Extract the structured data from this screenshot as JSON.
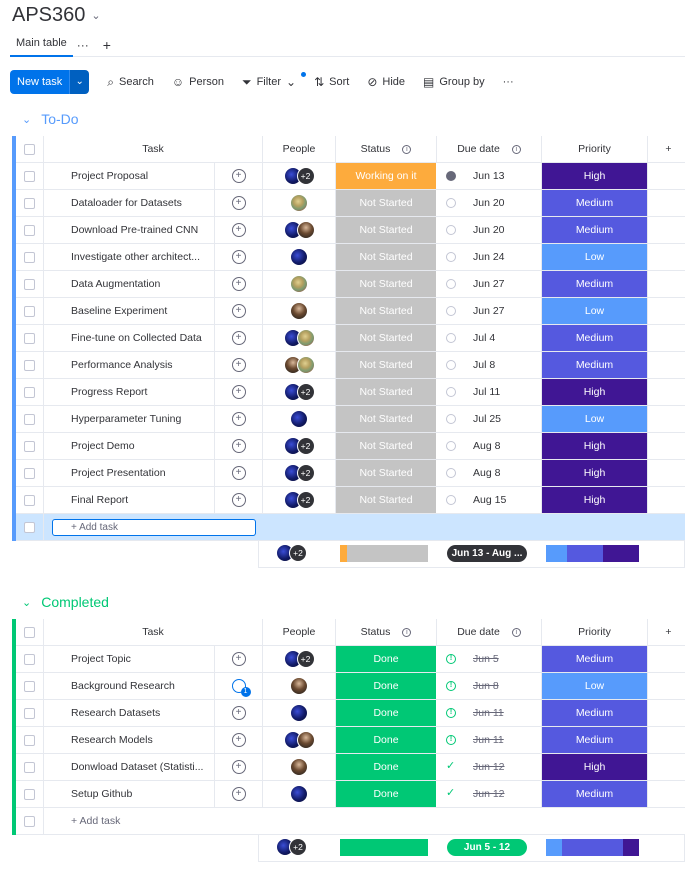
{
  "board": {
    "title": "APS360"
  },
  "view": {
    "tab_label": "Main table",
    "more": "···",
    "add": "+"
  },
  "toolbar": {
    "new_task": "New task",
    "search": "Search",
    "person": "Person",
    "filter": "Filter",
    "sort": "Sort",
    "hide": "Hide",
    "group_by": "Group by",
    "more": "···"
  },
  "columns": {
    "task": "Task",
    "people": "People",
    "status": "Status",
    "due": "Due date",
    "priority": "Priority"
  },
  "colors": {
    "working": "#fdab3d",
    "not_started": "#c4c4c4",
    "done": "#00c875",
    "high": "#401694",
    "medium": "#5559df",
    "low": "#579bfc",
    "todo_group": "#579bfc",
    "completed_group": "#00c875"
  },
  "todo": {
    "title": "To-Do",
    "add_label": "+ Add task",
    "rows": [
      {
        "task": "Project Proposal",
        "people": [
          "a",
          "+2"
        ],
        "status": "Working on it",
        "skey": "working",
        "due_icon": "fill",
        "due": "Jun 13",
        "priority": "High",
        "pkey": "high"
      },
      {
        "task": "Dataloader for Datasets",
        "people": [
          "b"
        ],
        "status": "Not Started",
        "skey": "not_started",
        "due_icon": "circ",
        "due": "Jun 20",
        "priority": "Medium",
        "pkey": "medium"
      },
      {
        "task": "Download Pre-trained CNN",
        "people": [
          "a",
          "c"
        ],
        "status": "Not Started",
        "skey": "not_started",
        "due_icon": "circ",
        "due": "Jun 20",
        "priority": "Medium",
        "pkey": "medium"
      },
      {
        "task": "Investigate other architect...",
        "people": [
          "a"
        ],
        "status": "Not Started",
        "skey": "not_started",
        "due_icon": "circ",
        "due": "Jun 24",
        "priority": "Low",
        "pkey": "low"
      },
      {
        "task": "Data Augmentation",
        "people": [
          "b"
        ],
        "status": "Not Started",
        "skey": "not_started",
        "due_icon": "circ",
        "due": "Jun 27",
        "priority": "Medium",
        "pkey": "medium"
      },
      {
        "task": "Baseline Experiment",
        "people": [
          "c"
        ],
        "status": "Not Started",
        "skey": "not_started",
        "due_icon": "circ",
        "due": "Jun 27",
        "priority": "Low",
        "pkey": "low"
      },
      {
        "task": "Fine-tune on Collected Data",
        "people": [
          "a",
          "b"
        ],
        "status": "Not Started",
        "skey": "not_started",
        "due_icon": "circ",
        "due": "Jul 4",
        "priority": "Medium",
        "pkey": "medium"
      },
      {
        "task": "Performance Analysis",
        "people": [
          "c",
          "b"
        ],
        "status": "Not Started",
        "skey": "not_started",
        "due_icon": "circ",
        "due": "Jul 8",
        "priority": "Medium",
        "pkey": "medium"
      },
      {
        "task": "Progress Report",
        "people": [
          "a",
          "+2"
        ],
        "status": "Not Started",
        "skey": "not_started",
        "due_icon": "circ",
        "due": "Jul 11",
        "priority": "High",
        "pkey": "high"
      },
      {
        "task": "Hyperparameter Tuning",
        "people": [
          "a"
        ],
        "status": "Not Started",
        "skey": "not_started",
        "due_icon": "circ",
        "due": "Jul 25",
        "priority": "Low",
        "pkey": "low"
      },
      {
        "task": "Project Demo",
        "people": [
          "a",
          "+2"
        ],
        "status": "Not Started",
        "skey": "not_started",
        "due_icon": "circ",
        "due": "Aug 8",
        "priority": "High",
        "pkey": "high"
      },
      {
        "task": "Project Presentation",
        "people": [
          "a",
          "+2"
        ],
        "status": "Not Started",
        "skey": "not_started",
        "due_icon": "circ",
        "due": "Aug 8",
        "priority": "High",
        "pkey": "high"
      },
      {
        "task": "Final Report",
        "people": [
          "a",
          "+2"
        ],
        "status": "Not Started",
        "skey": "not_started",
        "due_icon": "circ",
        "due": "Aug 15",
        "priority": "High",
        "pkey": "high"
      }
    ],
    "summary": {
      "people": [
        "a",
        "+2"
      ],
      "status_split": [
        {
          "key": "working",
          "frac": 0.08
        },
        {
          "key": "not_started",
          "frac": 0.92
        }
      ],
      "due_range": "Jun 13 - Aug ...",
      "due_color": "#323338",
      "priority_split": [
        {
          "key": "low",
          "frac": 0.23
        },
        {
          "key": "medium",
          "frac": 0.38
        },
        {
          "key": "high",
          "frac": 0.39
        }
      ]
    }
  },
  "completed": {
    "title": "Completed",
    "add_label": "+ Add task",
    "rows": [
      {
        "task": "Project Topic",
        "people": [
          "a",
          "+2"
        ],
        "update_badge": "",
        "status": "Done",
        "skey": "done",
        "due_icon": "warn",
        "due": "Jun 5",
        "priority": "Medium",
        "pkey": "medium"
      },
      {
        "task": "Background Research",
        "people": [
          "c"
        ],
        "update_badge": "1",
        "status": "Done",
        "skey": "done",
        "due_icon": "warn",
        "due": "Jun 8",
        "priority": "Low",
        "pkey": "low"
      },
      {
        "task": "Research Datasets",
        "people": [
          "a"
        ],
        "update_badge": "",
        "status": "Done",
        "skey": "done",
        "due_icon": "warn",
        "due": "Jun 11",
        "priority": "Medium",
        "pkey": "medium"
      },
      {
        "task": "Research Models",
        "people": [
          "a",
          "c"
        ],
        "update_badge": "",
        "status": "Done",
        "skey": "done",
        "due_icon": "warn",
        "due": "Jun 11",
        "priority": "Medium",
        "pkey": "medium"
      },
      {
        "task": "Donwload Dataset (Statisti...",
        "people": [
          "c"
        ],
        "update_badge": "",
        "status": "Done",
        "skey": "done",
        "due_icon": "check",
        "due": "Jun 12",
        "priority": "High",
        "pkey": "high"
      },
      {
        "task": "Setup Github",
        "people": [
          "a"
        ],
        "update_badge": "",
        "status": "Done",
        "skey": "done",
        "due_icon": "check",
        "due": "Jun 12",
        "priority": "Medium",
        "pkey": "medium"
      }
    ],
    "summary": {
      "people": [
        "a",
        "+2"
      ],
      "status_split": [
        {
          "key": "done",
          "frac": 1.0
        }
      ],
      "due_range": "Jun 5 - 12",
      "due_color": "#00c875",
      "priority_split": [
        {
          "key": "low",
          "frac": 0.17
        },
        {
          "key": "medium",
          "frac": 0.66
        },
        {
          "key": "high",
          "frac": 0.17
        }
      ]
    }
  }
}
